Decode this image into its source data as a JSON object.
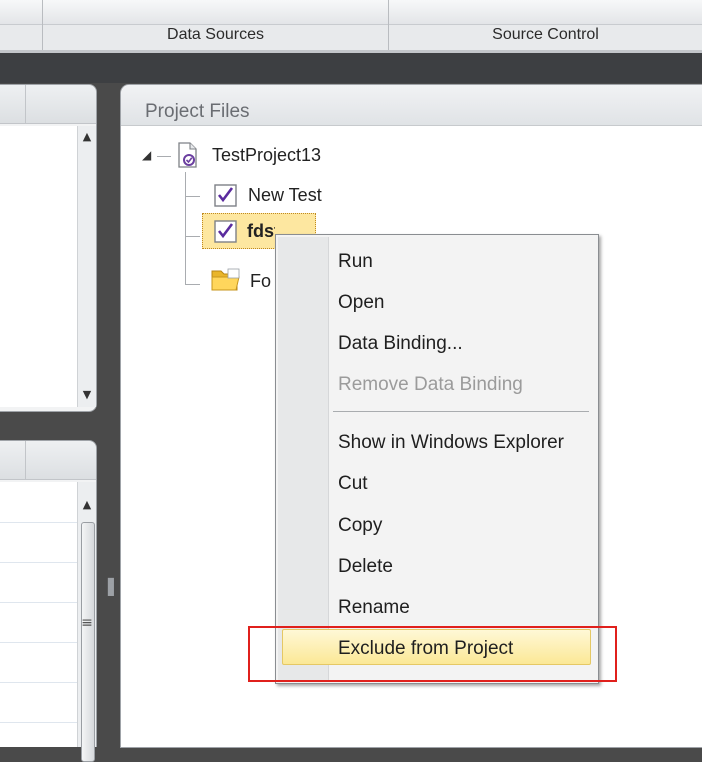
{
  "ribbon": {
    "tabs": [
      {
        "label": ""
      },
      {
        "label": "Data Sources"
      },
      {
        "label": "Source Control"
      }
    ]
  },
  "project_files": {
    "title": "Project Files",
    "tree": {
      "root": {
        "label": "TestProject13",
        "expanded": true,
        "icon": "project-file-icon"
      },
      "children": [
        {
          "label": "New Test",
          "icon": "test-checkbox-icon"
        },
        {
          "label": "fdsf d",
          "icon": "test-checkbox-icon",
          "selected": true
        },
        {
          "label": "Fo",
          "icon": "folder-icon"
        }
      ]
    }
  },
  "context_menu": {
    "items": [
      {
        "label": "Run",
        "enabled": true
      },
      {
        "label": "Open",
        "enabled": true
      },
      {
        "label": "Data Binding...",
        "enabled": true
      },
      {
        "label": "Remove Data Binding",
        "enabled": false
      },
      {
        "label": "Show in Windows Explorer",
        "enabled": true
      },
      {
        "label": "Cut",
        "enabled": true
      },
      {
        "label": "Copy",
        "enabled": true
      },
      {
        "label": "Delete",
        "enabled": true
      },
      {
        "label": "Rename",
        "enabled": true
      },
      {
        "label": "Exclude from Project",
        "enabled": true,
        "highlighted": true
      }
    ]
  },
  "colors": {
    "highlight_box": "#e0201c",
    "selection": "#fde7a0",
    "hover": "#fbe896"
  }
}
